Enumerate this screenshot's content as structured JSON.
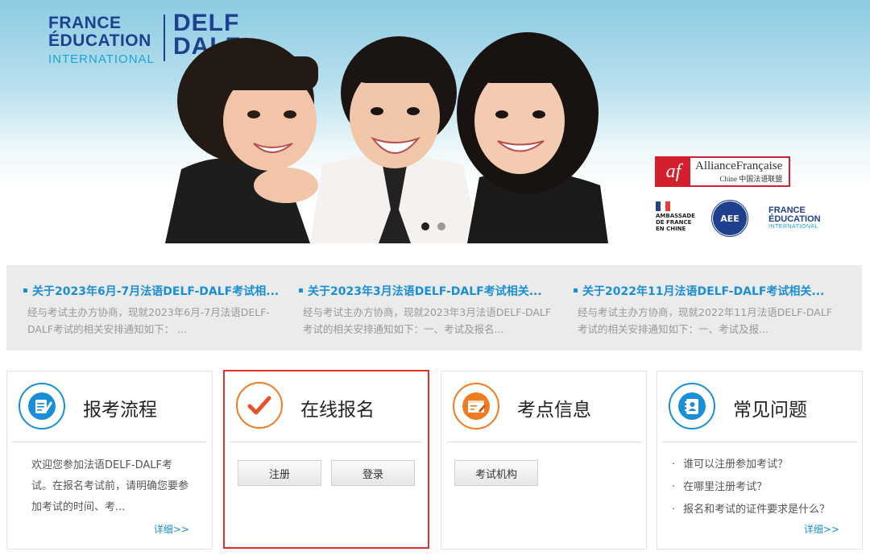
{
  "banner": {
    "logo_fei": {
      "line1": "FRANCE",
      "line2": "ÉDUCATION",
      "line3": "INTERNATIONAL"
    },
    "logo_delf": {
      "line1": "DELF",
      "line2": "DALF"
    },
    "af_logo": {
      "mark": "af",
      "name": "AllianceFrançaise",
      "sub": "Chine 中国法语联盟"
    },
    "embassy": {
      "line1": "AMBASSADE",
      "line2": "DE FRANCE",
      "line3": "EN CHINE"
    },
    "aee": {
      "label": "AEE"
    },
    "fei_small": {
      "line1": "FRANCE",
      "line2": "ÉDUCATION",
      "line3": "INTERNATIONAL"
    },
    "carousel_dots": 2,
    "active_dot": 1
  },
  "news": [
    {
      "title": "关于2023年6月-7月法语DELF-DALF考试相...",
      "body": "经与考试主办方协商，现就2023年6月-7月法语DELF-DALF考试的相关安排通知如下：   ..."
    },
    {
      "title": "关于2023年3月法语DELF-DALF考试相关...",
      "body": "经与考试主办方协商，现就2023年3月法语DELF-DALF考试的相关安排通知如下：一、考试及报名..."
    },
    {
      "title": "关于2022年11月法语DELF-DALF考试相关...",
      "body": "经与考试主办方协商，现就2022年11月法语DELF-DALF考试的相关安排通知如下：一、考试及报..."
    }
  ],
  "cards": {
    "process": {
      "title": "报考流程",
      "body": "欢迎您参加法语DELF-DALF考试。在报名考试前，请明确您要参加考试的时间、考...",
      "more": "详细>>",
      "icon": "document-pen-icon"
    },
    "register": {
      "title": "在线报名",
      "register_btn": "注册",
      "login_btn": "登录",
      "icon": "checkmark-icon"
    },
    "centers": {
      "title": "考点信息",
      "institution_btn": "考试机构",
      "icon": "browser-form-icon"
    },
    "faq": {
      "title": "常见问题",
      "items": [
        "谁可以注册参加考试？",
        "在哪里注册考试？",
        "报名和考试的证件要求是什么？"
      ],
      "more": "详细>>",
      "icon": "contact-book-icon"
    }
  },
  "colors": {
    "accent_blue": "#1a8fd8",
    "highlight_red": "#e03030",
    "brand_navy": "#1f3f8f",
    "orange": "#f07b22"
  }
}
